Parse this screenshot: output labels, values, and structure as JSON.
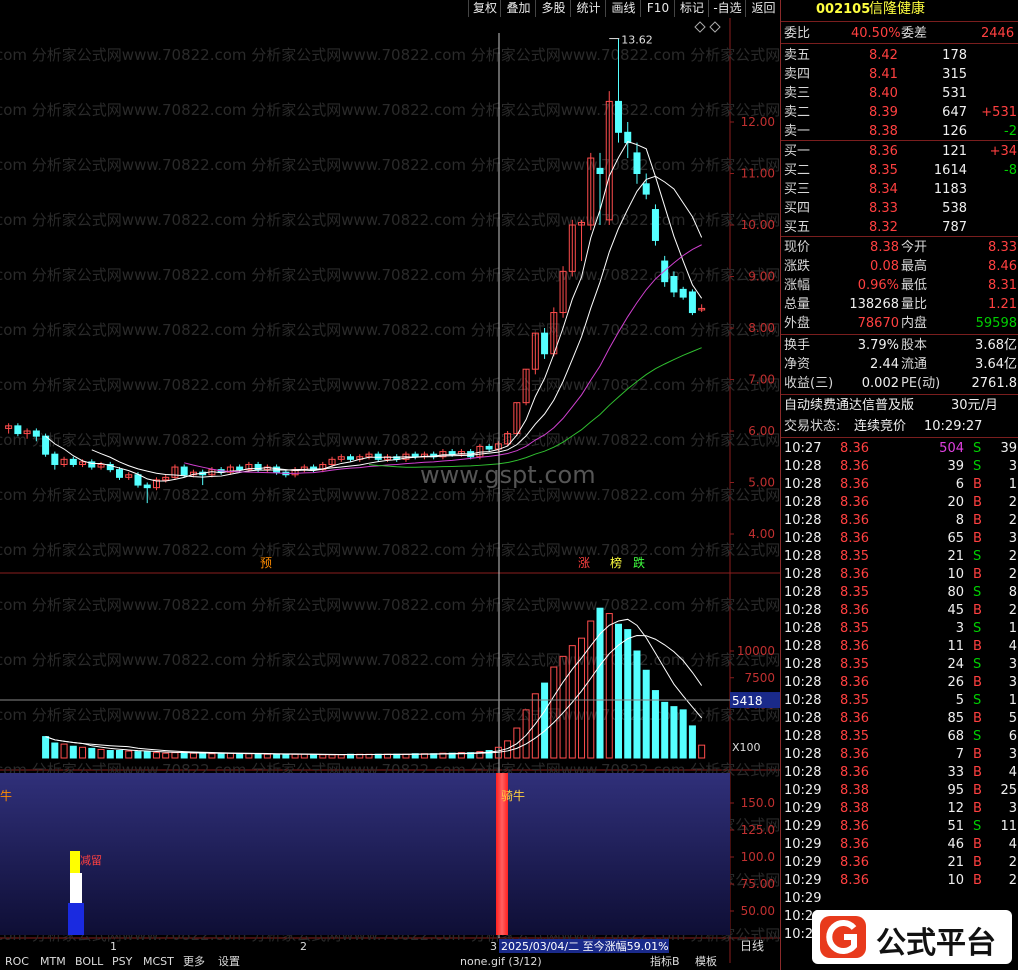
{
  "toolbar": {
    "buttons": [
      "复权",
      "叠加",
      "多股",
      "统计",
      "画线",
      "F10",
      "标记",
      "-自选",
      "返回"
    ]
  },
  "stock": {
    "code": "002105",
    "name": "信隆健康"
  },
  "price_chart": {
    "price_axis": [
      "12.00",
      "11.00",
      "10.00",
      "9.00",
      "8.00",
      "7.00",
      "6.00",
      "5.00",
      "4.00"
    ],
    "high_label": "13.62",
    "watermark": "www.gspt.com",
    "bg_watermark": "com 分析家公式网www.70822.com 分析家公式网www.70822.com 分析家公式网www.70822.com 分析家公式网www.70822.com",
    "markers": [
      {
        "text": "预",
        "color": "#ff8c00"
      },
      {
        "text": "涨",
        "color": "#ff4040"
      },
      {
        "text": "榜",
        "color": "#ffff40"
      },
      {
        "text": "跌",
        "color": "#40ff40"
      }
    ]
  },
  "volume_chart": {
    "axis": [
      "10000",
      "7500",
      "5000"
    ],
    "current_label": "5418",
    "unit": "X100"
  },
  "indicator_chart": {
    "axis": [
      "150.0",
      "125.0",
      "100.0",
      "75.00",
      "50.00"
    ],
    "left_label": "牛",
    "mid_label": "骑牛",
    "small_label": "减留",
    "date_info": "2025/03/04/二 至今涨幅59.01%",
    "xaxis": [
      "1",
      "2",
      "3"
    ]
  },
  "bottom_tabs": [
    "ROC",
    "MTM",
    "BOLL",
    "PSY",
    "MCST",
    "更多",
    "设置"
  ],
  "bottom_caption": "none.gif (3/12)",
  "bottom_right": [
    "指标B",
    "模板"
  ],
  "period": "日线",
  "quote": {
    "weibi_label": "委比",
    "weibi": "40.50%",
    "weicha_label": "委差",
    "weicha": "2446",
    "asks": [
      {
        "label": "卖五",
        "price": "8.42",
        "vol": "178",
        "chg": ""
      },
      {
        "label": "卖四",
        "price": "8.41",
        "vol": "315",
        "chg": ""
      },
      {
        "label": "卖三",
        "price": "8.40",
        "vol": "531",
        "chg": ""
      },
      {
        "label": "卖二",
        "price": "8.39",
        "vol": "647",
        "chg": "+531"
      },
      {
        "label": "卖一",
        "price": "8.38",
        "vol": "126",
        "chg": "-2"
      }
    ],
    "bids": [
      {
        "label": "买一",
        "price": "8.36",
        "vol": "121",
        "chg": "+34"
      },
      {
        "label": "买二",
        "price": "8.35",
        "vol": "1614",
        "chg": "-8"
      },
      {
        "label": "买三",
        "price": "8.34",
        "vol": "1183",
        "chg": ""
      },
      {
        "label": "买四",
        "price": "8.33",
        "vol": "538",
        "chg": ""
      },
      {
        "label": "买五",
        "price": "8.32",
        "vol": "787",
        "chg": ""
      }
    ],
    "stats": [
      {
        "l1": "现价",
        "v1": "8.38",
        "c1": "red",
        "l2": "今开",
        "v2": "8.33",
        "c2": "red"
      },
      {
        "l1": "涨跌",
        "v1": "0.08",
        "c1": "red",
        "l2": "最高",
        "v2": "8.46",
        "c2": "red"
      },
      {
        "l1": "涨幅",
        "v1": "0.96%",
        "c1": "red",
        "l2": "最低",
        "v2": "8.31",
        "c2": "red"
      },
      {
        "l1": "总量",
        "v1": "138268",
        "c1": "white",
        "l2": "量比",
        "v2": "1.21",
        "c2": "red"
      },
      {
        "l1": "外盘",
        "v1": "78670",
        "c1": "red",
        "l2": "内盘",
        "v2": "59598",
        "c2": "green"
      }
    ],
    "stats2": [
      {
        "l1": "换手",
        "v1": "3.79%",
        "l2": "股本",
        "v2": "3.68亿"
      },
      {
        "l1": "净资",
        "v1": "2.44",
        "l2": "流通",
        "v2": "3.64亿"
      },
      {
        "l1": "收益(三)",
        "v1": "0.002",
        "l2": "PE(动)",
        "v2": "2761.8"
      }
    ],
    "promo": "自动续费通达信普及版",
    "price_month": "30元/月",
    "trade_status_label": "交易状态:",
    "trade_status": "连续竞价",
    "trade_time": "10:29:27"
  },
  "ticks": [
    {
      "t": "10:27",
      "p": "8.36",
      "v": "504",
      "s": "S",
      "n": "39"
    },
    {
      "t": "10:28",
      "p": "8.36",
      "v": "39",
      "s": "S",
      "n": "3"
    },
    {
      "t": "10:28",
      "p": "8.36",
      "v": "6",
      "s": "B",
      "n": "1"
    },
    {
      "t": "10:28",
      "p": "8.36",
      "v": "20",
      "s": "B",
      "n": "2"
    },
    {
      "t": "10:28",
      "p": "8.36",
      "v": "8",
      "s": "B",
      "n": "2"
    },
    {
      "t": "10:28",
      "p": "8.36",
      "v": "65",
      "s": "B",
      "n": "3"
    },
    {
      "t": "10:28",
      "p": "8.35",
      "v": "21",
      "s": "S",
      "n": "2"
    },
    {
      "t": "10:28",
      "p": "8.36",
      "v": "10",
      "s": "B",
      "n": "2"
    },
    {
      "t": "10:28",
      "p": "8.35",
      "v": "80",
      "s": "S",
      "n": "8"
    },
    {
      "t": "10:28",
      "p": "8.36",
      "v": "45",
      "s": "B",
      "n": "2"
    },
    {
      "t": "10:28",
      "p": "8.35",
      "v": "3",
      "s": "S",
      "n": "1"
    },
    {
      "t": "10:28",
      "p": "8.36",
      "v": "11",
      "s": "B",
      "n": "4"
    },
    {
      "t": "10:28",
      "p": "8.35",
      "v": "24",
      "s": "S",
      "n": "3"
    },
    {
      "t": "10:28",
      "p": "8.36",
      "v": "26",
      "s": "B",
      "n": "3"
    },
    {
      "t": "10:28",
      "p": "8.35",
      "v": "5",
      "s": "S",
      "n": "1"
    },
    {
      "t": "10:28",
      "p": "8.36",
      "v": "85",
      "s": "B",
      "n": "5"
    },
    {
      "t": "10:28",
      "p": "8.35",
      "v": "68",
      "s": "S",
      "n": "6"
    },
    {
      "t": "10:28",
      "p": "8.36",
      "v": "7",
      "s": "B",
      "n": "3"
    },
    {
      "t": "10:28",
      "p": "8.36",
      "v": "33",
      "s": "B",
      "n": "4"
    },
    {
      "t": "10:29",
      "p": "8.38",
      "v": "95",
      "s": "B",
      "n": "25"
    },
    {
      "t": "10:29",
      "p": "8.38",
      "v": "12",
      "s": "B",
      "n": "3"
    },
    {
      "t": "10:29",
      "p": "8.36",
      "v": "51",
      "s": "S",
      "n": "11"
    },
    {
      "t": "10:29",
      "p": "8.36",
      "v": "46",
      "s": "B",
      "n": "4"
    },
    {
      "t": "10:29",
      "p": "8.36",
      "v": "21",
      "s": "B",
      "n": "2"
    },
    {
      "t": "10:29",
      "p": "8.36",
      "v": "10",
      "s": "B",
      "n": "2"
    },
    {
      "t": "10:29",
      "p": "",
      "v": "",
      "s": "",
      "n": ""
    },
    {
      "t": "10:29",
      "p": "",
      "v": "",
      "s": "",
      "n": ""
    },
    {
      "t": "10:29",
      "p": "",
      "v": "",
      "s": "",
      "n": ""
    }
  ],
  "logo": {
    "text": "公式平台"
  }
}
